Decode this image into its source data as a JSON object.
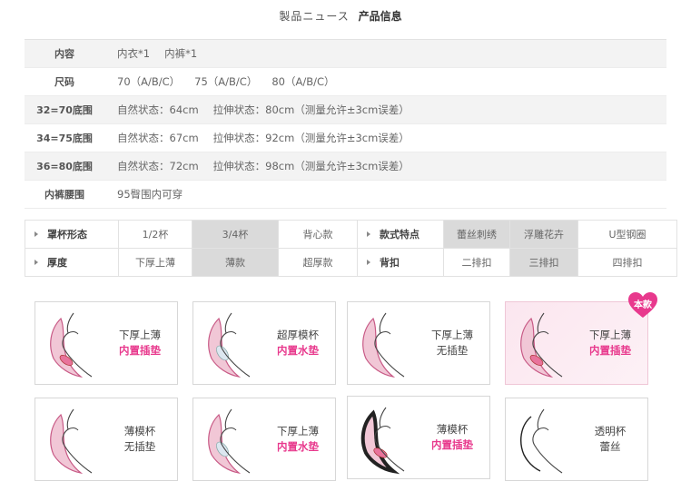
{
  "header": {
    "jp": "製品ニュース",
    "cn": "产品信息"
  },
  "size_table": [
    {
      "label": "内容",
      "parts": [
        "内衣*1",
        "内裤*1"
      ]
    },
    {
      "label": "尺码",
      "parts": [
        "70（A/B/C）",
        "75（A/B/C）",
        "80（A/B/C）"
      ]
    },
    {
      "label": "32=70底围",
      "parts": [
        "自然状态：64cm",
        "拉伸状态：80cm（测量允许±3cm误差）"
      ]
    },
    {
      "label": "34=75底围",
      "parts": [
        "自然状态：67cm",
        "拉伸状态：92cm（测量允许±3cm误差）"
      ]
    },
    {
      "label": "36=80底围",
      "parts": [
        "自然状态：72cm",
        "拉伸状态：98cm（测量允许±3cm误差）"
      ]
    },
    {
      "label": "内裤腰围",
      "parts": [
        "95臀围内可穿"
      ]
    }
  ],
  "attributes": {
    "row1": {
      "head_a": "罩杯形态",
      "opts_a": [
        "1/2杯",
        "3/4杯",
        "背心款"
      ],
      "sel_a": 1,
      "head_b": "款式特点",
      "opts_b": [
        "蕾丝刺绣",
        "浮雕花卉",
        "U型钢圈"
      ],
      "sel_b": [
        0,
        1
      ]
    },
    "row2": {
      "head_a": "厚度",
      "opts_a": [
        "下厚上薄",
        "薄款",
        "超厚款"
      ],
      "sel_a": 1,
      "head_b": "背扣",
      "opts_b": [
        "二排扣",
        "三排扣",
        "四排扣"
      ],
      "sel_b": [
        1
      ]
    }
  },
  "cards": [
    {
      "line1": "下厚上薄",
      "line2": "内置插垫",
      "line2_pink": true,
      "featured": false,
      "style": "pad"
    },
    {
      "line1": "超厚模杯",
      "line2": "内置水垫",
      "line2_pink": true,
      "featured": false,
      "style": "water"
    },
    {
      "line1": "下厚上薄",
      "line2": "无插垫",
      "line2_pink": false,
      "featured": false,
      "style": "plain"
    },
    {
      "line1": "下厚上薄",
      "line2": "内置插垫",
      "line2_pink": true,
      "featured": true,
      "style": "pad",
      "badge": "本款"
    },
    {
      "line1": "薄模杯",
      "line2": "无插垫",
      "line2_pink": false,
      "featured": false,
      "style": "thin"
    },
    {
      "line1": "下厚上薄",
      "line2": "内置水垫",
      "line2_pink": true,
      "featured": false,
      "style": "water"
    },
    {
      "line1": "薄模杯",
      "line2": "内置插垫",
      "line2_pink": true,
      "featured": false,
      "style": "thinpad"
    },
    {
      "line1": "透明杯",
      "line2": "蕾丝",
      "line2_pink": false,
      "featured": false,
      "style": "lace"
    }
  ],
  "colors": {
    "accent": "#e8398d",
    "cup": "#f1c7d6",
    "cup_stroke": "#c85a86",
    "pad": "#e8739b",
    "water": "#dce7f0"
  }
}
